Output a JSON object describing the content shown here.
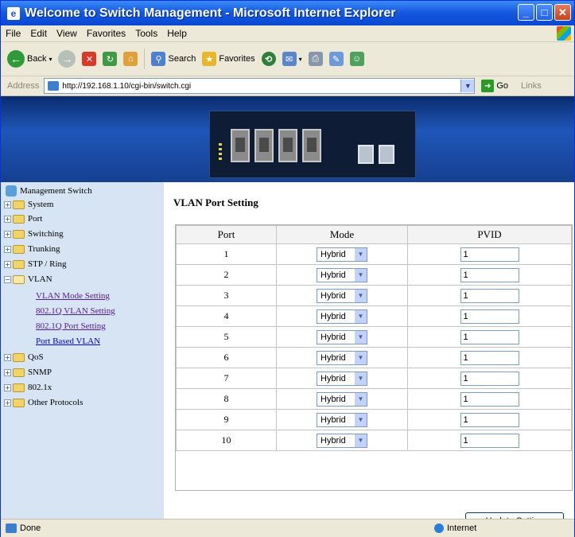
{
  "window": {
    "title": "Welcome to Switch Management - Microsoft Internet Explorer",
    "controls": [
      "minimize",
      "maximize",
      "close"
    ]
  },
  "menu": [
    "File",
    "Edit",
    "View",
    "Favorites",
    "Tools",
    "Help"
  ],
  "toolbar": {
    "back_label": "Back",
    "search_label": "Search",
    "favorites_label": "Favorites"
  },
  "address": {
    "label": "Address",
    "url": "http://192.168.1.10/cgi-bin/switch.cgi",
    "go_label": "Go",
    "links_label": "Links"
  },
  "sidebar": {
    "root": "Management Switch",
    "items": [
      {
        "label": "System",
        "expanded": false
      },
      {
        "label": "Port",
        "expanded": false
      },
      {
        "label": "Switching",
        "expanded": false
      },
      {
        "label": "Trunking",
        "expanded": false
      },
      {
        "label": "STP / Ring",
        "expanded": false
      },
      {
        "label": "VLAN",
        "expanded": true
      },
      {
        "label": "QoS",
        "expanded": false
      },
      {
        "label": "SNMP",
        "expanded": false
      },
      {
        "label": "802.1x",
        "expanded": false
      },
      {
        "label": "Other Protocols",
        "expanded": false
      }
    ],
    "vlan_links": [
      "VLAN Mode Setting",
      "802.1Q VLAN Setting",
      "802.1Q Port Setting",
      "Port Based VLAN"
    ]
  },
  "main": {
    "heading": "VLAN Port Setting",
    "columns": [
      "Port",
      "Mode",
      "PVID"
    ],
    "rows": [
      {
        "port": "1",
        "mode": "Hybrid",
        "pvid": "1"
      },
      {
        "port": "2",
        "mode": "Hybrid",
        "pvid": "1"
      },
      {
        "port": "3",
        "mode": "Hybrid",
        "pvid": "1"
      },
      {
        "port": "4",
        "mode": "Hybrid",
        "pvid": "1"
      },
      {
        "port": "5",
        "mode": "Hybrid",
        "pvid": "1"
      },
      {
        "port": "6",
        "mode": "Hybrid",
        "pvid": "1"
      },
      {
        "port": "7",
        "mode": "Hybrid",
        "pvid": "1"
      },
      {
        "port": "8",
        "mode": "Hybrid",
        "pvid": "1"
      },
      {
        "port": "9",
        "mode": "Hybrid",
        "pvid": "1"
      },
      {
        "port": "10",
        "mode": "Hybrid",
        "pvid": "1"
      }
    ],
    "update_button": "Update Setting"
  },
  "status": {
    "text": "Done",
    "zone": "Internet"
  },
  "colors": {
    "titlebar": "#0a48d1",
    "sidebar_bg": "#d6e4f3",
    "banner": "#1f56b8"
  }
}
